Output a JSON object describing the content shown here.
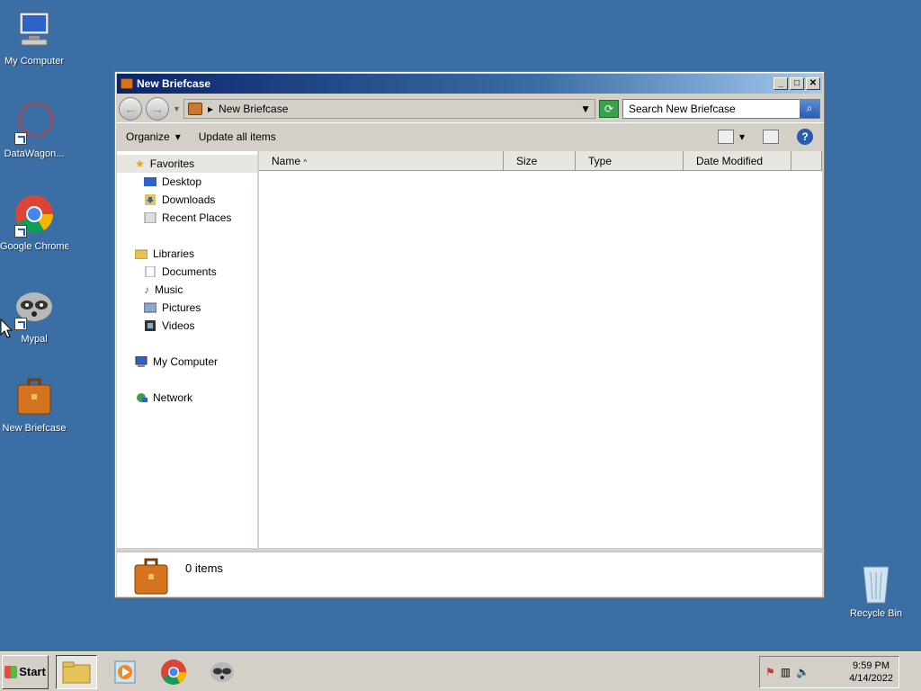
{
  "desktop": {
    "icons": [
      {
        "label": "My Computer",
        "icon": "computer-icon"
      },
      {
        "label": "DataWagon...",
        "icon": "datawagon-icon"
      },
      {
        "label": "Google Chrome",
        "icon": "chrome-icon"
      },
      {
        "label": "Mypal",
        "icon": "raccoon-icon"
      },
      {
        "label": "New Briefcase",
        "icon": "briefcase-icon"
      },
      {
        "label": "Recycle Bin",
        "icon": "recycle-bin-icon"
      }
    ]
  },
  "window": {
    "title": "New Briefcase",
    "address": "New Briefcase",
    "search_placeholder": "Search New Briefcase",
    "toolbar": {
      "organize": "Organize",
      "update": "Update all items"
    },
    "nav": {
      "favorites": "Favorites",
      "favorites_items": [
        "Desktop",
        "Downloads",
        "Recent Places"
      ],
      "libraries": "Libraries",
      "libraries_items": [
        "Documents",
        "Music",
        "Pictures",
        "Videos"
      ],
      "computer": "My Computer",
      "network": "Network"
    },
    "columns": [
      "Name",
      "Size",
      "Type",
      "Date Modified"
    ],
    "status": "0 items"
  },
  "taskbar": {
    "start": "Start",
    "time": "9:59 PM",
    "date": "4/14/2022"
  }
}
